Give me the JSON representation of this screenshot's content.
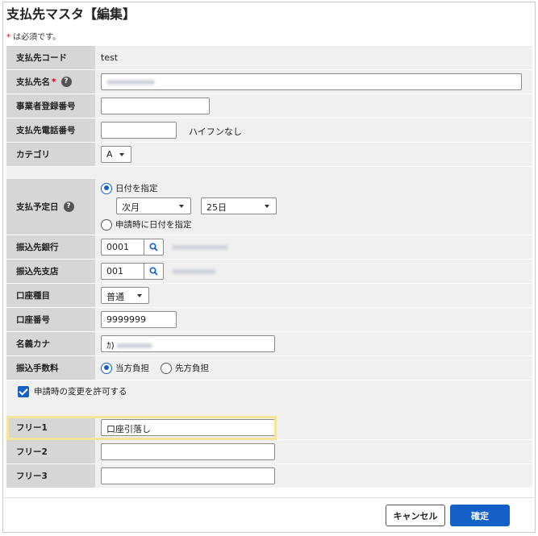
{
  "title": "支払先マスタ【編集】",
  "required_note": {
    "mark": "*",
    "text": " は必須です。"
  },
  "fields": {
    "code": {
      "label": "支払先コード",
      "value": "test"
    },
    "name": {
      "label": "支払先名",
      "required_mark": "*",
      "help": "?"
    },
    "reg_no": {
      "label": "事業者登録番号",
      "value": ""
    },
    "phone": {
      "label": "支払先電話番号",
      "value": "",
      "hint": "ハイフンなし"
    },
    "category": {
      "label": "カテゴリ",
      "selected": "A"
    },
    "pay_date": {
      "label": "支払予定日",
      "help": "?",
      "opt_specify": "日付を指定",
      "month_selected": "次月",
      "day_selected": "25日",
      "opt_on_apply": "申請時に日付を指定"
    },
    "bank": {
      "label": "振込先銀行",
      "value": "0001"
    },
    "branch": {
      "label": "振込先支店",
      "value": "001"
    },
    "acct_type": {
      "label": "口座種目",
      "selected": "普通"
    },
    "acct_no": {
      "label": "口座番号",
      "value": "9999999"
    },
    "kana": {
      "label": "名義カナ",
      "value_prefix": "ｶ)"
    },
    "fee": {
      "label": "振込手数料",
      "opt_ours": "当方負担",
      "opt_theirs": "先方負担"
    },
    "allow_change": {
      "label": "申請時の変更を許可する"
    },
    "free1": {
      "label": "フリー1",
      "value": "口座引落し"
    },
    "free2": {
      "label": "フリー2",
      "value": ""
    },
    "free3": {
      "label": "フリー3",
      "value": ""
    }
  },
  "buttons": {
    "cancel": "キャンセル",
    "confirm": "確定"
  },
  "colors": {
    "accent": "#1560c8",
    "label_bg": "#d6d6d6",
    "highlight": "#f3e39b",
    "required": "#d0021b"
  }
}
